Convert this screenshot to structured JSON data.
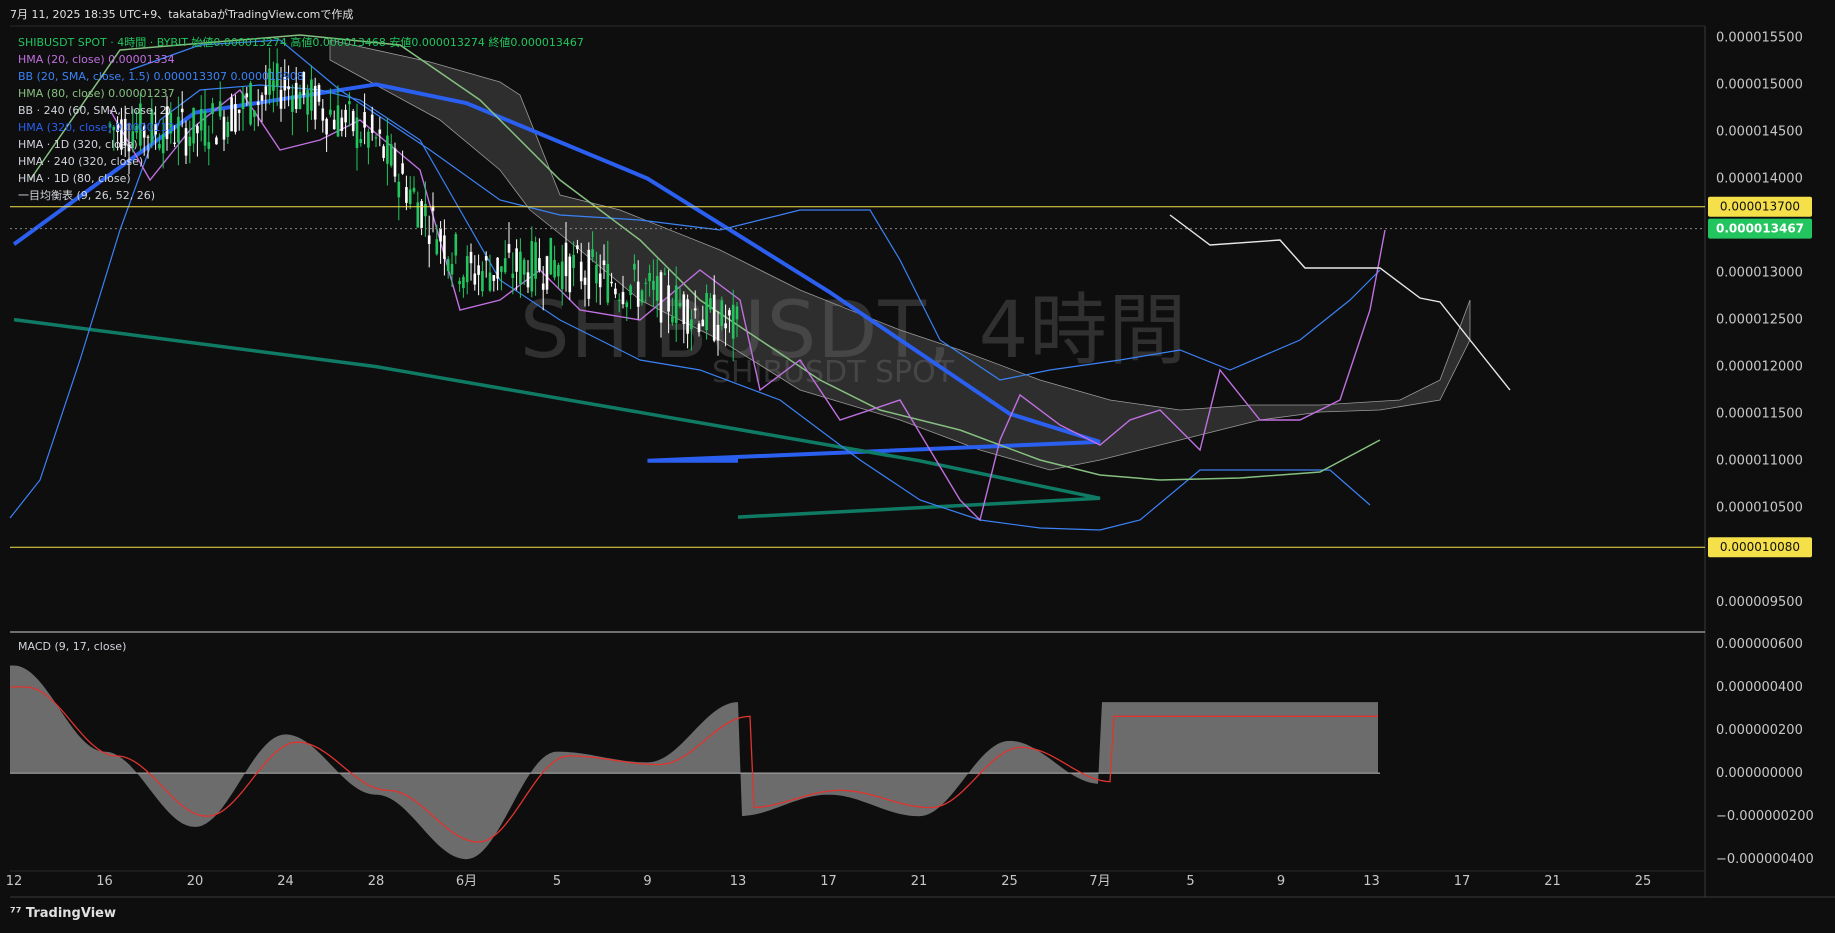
{
  "header": {
    "caption": "7月 11, 2025 18:35 UTC+9、takatabaがTradingView.comで作成"
  },
  "watermark": {
    "title": "SHIBUSDT, 4時間",
    "subtitle": "SHIBUSDT SPOT"
  },
  "legend": {
    "main": "SHIBUSDT SPOT · 4時間 · BYBIT  始値0.000013274  高値0.000013468  安値0.000013274  終値0.000013467",
    "items": [
      "HMA (20, close)  0.00001334",
      "BB (20, SMA, close, 1.5)  0.000013307  0.000010908",
      "HMA (80, close)  0.00001237",
      "BB · 240 (60, SMA, close, 2)",
      "HMA (320, close)  0.0000112",
      "HMA · 1D (320, close)",
      "HMA · 240 (320, close)",
      "HMA · 1D (80, close)",
      "一目均衡表 (9, 26, 52, 26)"
    ]
  },
  "macd_legend": "MACD (9, 17, close)",
  "brand": "TradingView",
  "colors": {
    "bg": "#0e0e0e",
    "up": "#22c55e",
    "down": "#ffffff",
    "hline": "#f5e04a",
    "hma_blue": "#2a5ff0",
    "hma_teal": "#0f7b64",
    "macd_signal": "#e0342f",
    "macd_hist": "#8a8a8a",
    "bb": "#3b82f6",
    "purple": "#c070e0",
    "green_line": "#86c080"
  },
  "chart_data": [
    {
      "type": "line",
      "title": "SHIBUSDT, 4時間",
      "ylim": [
        9.2e-06,
        1.56e-05
      ],
      "y_ticks": [
        "0.000015500",
        "0.000015000",
        "0.000014500",
        "0.000014000",
        "0.000013000",
        "0.000012500",
        "0.000012000",
        "0.000011500",
        "0.000011000",
        "0.000010500",
        "0.000009500"
      ],
      "x_ticks": [
        "12",
        "16",
        "20",
        "24",
        "28",
        "6月",
        "5",
        "9",
        "13",
        "17",
        "21",
        "25",
        "7月",
        "5",
        "9",
        "13",
        "17",
        "21",
        "25"
      ],
      "horizontal_levels": [
        {
          "value": 1.37e-05,
          "label": "0.000013700"
        },
        {
          "value": 1.008e-05,
          "label": "0.000010080"
        }
      ],
      "last_price": {
        "value": 1.3467e-05,
        "label": "0.000013467"
      },
      "series": [
        {
          "name": "HMA (320, close)",
          "x": [
            "12",
            "20",
            "28",
            "6月",
            "9",
            "17",
            "25",
            "7月",
            "9",
            "13"
          ],
          "values": [
            1.33e-05,
            1.47e-05,
            1.5e-05,
            1.48e-05,
            1.4e-05,
            1.28e-05,
            1.15e-05,
            1.12e-05,
            1.1e-05,
            1.1e-05
          ]
        },
        {
          "name": "HMA · 1D (320, close)",
          "x": [
            "12",
            "28",
            "9",
            "21",
            "7月",
            "13"
          ],
          "values": [
            1.25e-05,
            1.2e-05,
            1.15e-05,
            1.1e-05,
            1.06e-05,
            1.04e-05
          ]
        },
        {
          "name": "SHIBUSDT close",
          "x": [
            "12",
            "20",
            "24",
            "28",
            "6月",
            "5",
            "9",
            "13",
            "17",
            "21",
            "25",
            "7月",
            "5",
            "9",
            "13"
          ],
          "values": [
            1.46e-05,
            1.45e-05,
            1.5e-05,
            1.44e-05,
            1.3e-05,
            1.31e-05,
            1.28e-05,
            1.24e-05,
            1.18e-05,
            1.05e-05,
            1.16e-05,
            1.14e-05,
            1.17e-05,
            1.18e-05,
            1.35e-05
          ]
        }
      ]
    },
    {
      "type": "area",
      "title": "MACD (9, 17, close)",
      "ylim": [
        -4.5e-07,
        6e-07
      ],
      "y_ticks": [
        "0.000000600",
        "0.000000400",
        "0.000000200",
        "0.000000000",
        "−0.000000200",
        "−0.000000400"
      ],
      "series": [
        {
          "name": "MACD",
          "x": [
            "12",
            "16",
            "20",
            "24",
            "28",
            "6月",
            "5",
            "9",
            "13",
            "17",
            "21",
            "25",
            "7月",
            "5",
            "9",
            "13"
          ],
          "values": [
            5e-07,
            1e-07,
            -2.5e-07,
            1.8e-07,
            -1e-07,
            -4e-07,
            1e-07,
            2e-07,
            -2e-07,
            -1e-07,
            -2e-07,
            1.5e-07,
            -5e-08,
            1e-07,
            5e-08,
            3.3e-07
          ]
        }
      ]
    }
  ]
}
